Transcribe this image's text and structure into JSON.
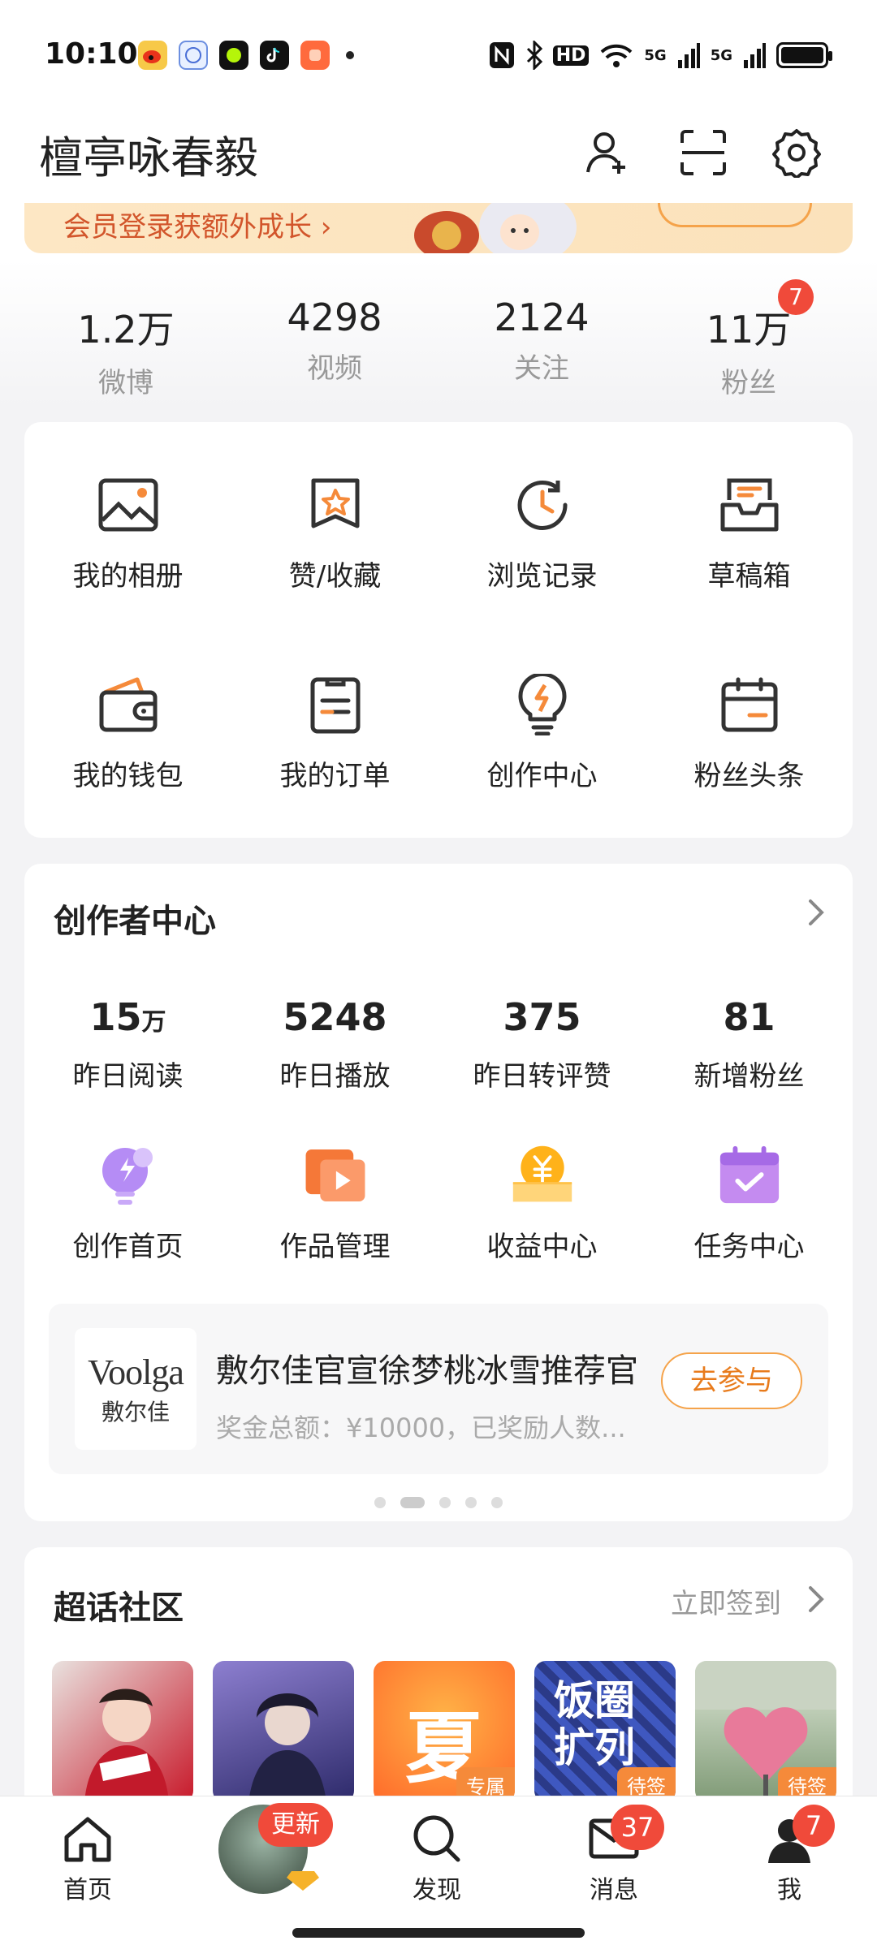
{
  "status_bar": {
    "time": "10:10",
    "apps": [
      {
        "icon": "weibo-icon",
        "color": "#f7c948"
      },
      {
        "icon": "ifly-icon",
        "color": "#e8f0ff"
      },
      {
        "icon": "green-dot-app-icon",
        "color": "#111111"
      },
      {
        "icon": "tiktok-icon",
        "color": "#111111"
      },
      {
        "icon": "orange-app-icon",
        "color": "#ff6a3d"
      }
    ],
    "hd_label": "HD",
    "network_labels": [
      "5G",
      "5G"
    ]
  },
  "header": {
    "username": "檀亭咏春毅",
    "icons": [
      "add-friend-icon",
      "scan-icon",
      "settings-icon"
    ]
  },
  "banner": {
    "text": "会员登录获额外成长 ›"
  },
  "stats": [
    {
      "value": "1.2万",
      "label": "微博"
    },
    {
      "value": "4298",
      "label": "视频"
    },
    {
      "value": "2124",
      "label": "关注"
    },
    {
      "value": "11万",
      "label": "粉丝",
      "badge": "7"
    }
  ],
  "shortcuts": [
    {
      "label": "我的相册",
      "icon": "album-icon"
    },
    {
      "label": "赞/收藏",
      "icon": "favorite-icon"
    },
    {
      "label": "浏览记录",
      "icon": "history-icon"
    },
    {
      "label": "草稿箱",
      "icon": "drafts-icon"
    },
    {
      "label": "我的钱包",
      "icon": "wallet-icon"
    },
    {
      "label": "我的订单",
      "icon": "orders-icon"
    },
    {
      "label": "创作中心",
      "icon": "creation-icon"
    },
    {
      "label": "粉丝头条",
      "icon": "fans-headline-icon"
    }
  ],
  "creator": {
    "title": "创作者中心",
    "metrics": [
      {
        "value": "15",
        "unit": "万",
        "label": "昨日阅读"
      },
      {
        "value": "5248",
        "unit": "",
        "label": "昨日播放"
      },
      {
        "value": "375",
        "unit": "",
        "label": "昨日转评赞"
      },
      {
        "value": "81",
        "unit": "",
        "label": "新增粉丝"
      }
    ],
    "tools": [
      {
        "label": "创作首页",
        "icon": "creation-home-icon"
      },
      {
        "label": "作品管理",
        "icon": "works-manage-icon"
      },
      {
        "label": "收益中心",
        "icon": "earnings-icon"
      },
      {
        "label": "任务中心",
        "icon": "tasks-icon"
      }
    ],
    "promo": {
      "logo_en": "Voolga",
      "logo_cn": "敷尔佳",
      "title": "敷尔佳官宣徐梦桃冰雪推荐官",
      "subtitle": "奖金总额：¥10000，已奖励人数...",
      "button": "去参与"
    },
    "carousel_dots": 5,
    "carousel_active": 2
  },
  "super_topic": {
    "title": "超话社区",
    "link": "立即签到",
    "items": [
      {
        "text": "",
        "tag": ""
      },
      {
        "text": "",
        "tag": ""
      },
      {
        "text": "夏",
        "tag": "专属"
      },
      {
        "text": "饭圈扩列",
        "tag": "待签"
      },
      {
        "text": "",
        "tag": "待签"
      }
    ]
  },
  "bottom_nav": [
    {
      "label": "首页",
      "icon": "home-icon"
    },
    {
      "label": "",
      "icon": "video-avatar-icon",
      "badge": "更新"
    },
    {
      "label": "发现",
      "icon": "discover-icon"
    },
    {
      "label": "消息",
      "icon": "message-icon",
      "badge": "37"
    },
    {
      "label": "我",
      "icon": "profile-icon",
      "badge": "7"
    }
  ],
  "colors": {
    "accent": "#f58a3a",
    "badge": "#f04a3a",
    "text": "#222222",
    "muted": "#999999"
  }
}
